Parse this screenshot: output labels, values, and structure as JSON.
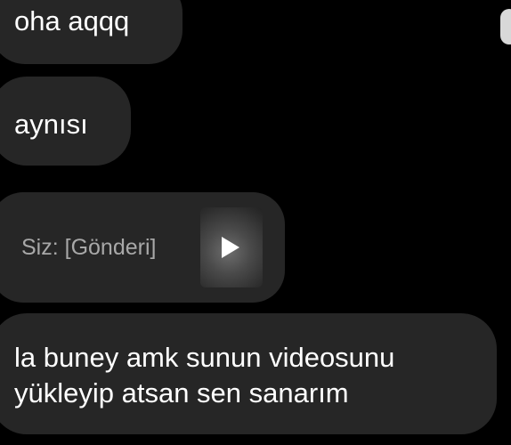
{
  "messages": [
    {
      "text": "oha aqqq"
    },
    {
      "text": "aynısı"
    },
    {
      "text": "Siz: [Gönderi]",
      "thumbnail_icon": "play-icon"
    },
    {
      "text": "la buney amk sunun videosunu\nyükleyip atsan sen sanarım"
    }
  ],
  "colors": {
    "background": "#000000",
    "bubble": "#262626",
    "text": "#ffffff",
    "secondary_text": "#a8a8a8"
  }
}
